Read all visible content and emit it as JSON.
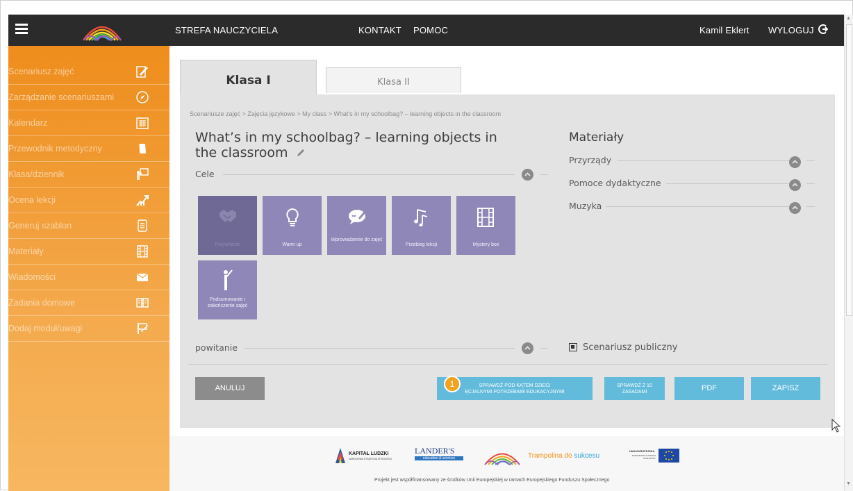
{
  "topbar": {
    "nav_strefa": "STREFA NAUCZYCIELA",
    "nav_kontakt": "KONTAKT",
    "nav_pomoc": "POMOC",
    "user_name": "Kamil Eklert",
    "logout": "WYLOGUJ"
  },
  "sidebar": {
    "items": [
      {
        "label": "Scenariusz zajęć",
        "icon": "edit-icon"
      },
      {
        "label": "Zarządzanie scenariuszami",
        "icon": "compass-icon"
      },
      {
        "label": "Kalendarz",
        "icon": "calendar-icon"
      },
      {
        "label": "Przewodnik metodyczny",
        "icon": "book-icon"
      },
      {
        "label": "Klasa/dziennik",
        "icon": "teacher-board-icon"
      },
      {
        "label": "Ocena lekcji",
        "icon": "chart-up-icon"
      },
      {
        "label": "Generuj szablon",
        "icon": "document-icon"
      },
      {
        "label": "Materiały",
        "icon": "film-icon"
      },
      {
        "label": "Wiadomości",
        "icon": "envelope-icon"
      },
      {
        "label": "Zadania domowe",
        "icon": "open-book-icon"
      },
      {
        "label": "Dodaj moduł/uwagi",
        "icon": "add-note-icon"
      }
    ]
  },
  "tabs": [
    {
      "label": "Klasa I",
      "active": true
    },
    {
      "label": "Klasa II",
      "active": false
    }
  ],
  "breadcrumb": "Scenariusze zajęć  >  Zajęcia językowe  >  My class  >  What's in my schoolbag? – learning objects in the classroom",
  "lesson": {
    "title": "What’s in my schoolbag? – learning objects in the classroom",
    "cele_label": "Cele",
    "powitanie_label": "powitanie"
  },
  "tiles": [
    {
      "label": "Przywitanie",
      "icon": "handshake-icon",
      "active": true
    },
    {
      "label": "Warm up",
      "icon": "lightbulb-icon",
      "active": false
    },
    {
      "label": "Wprowadzenie do zajęć",
      "icon": "speech-pen-icon",
      "active": false
    },
    {
      "label": "Przebieg lekcji",
      "icon": "music-note-icon",
      "active": false
    },
    {
      "label": "Mystery box",
      "icon": "film-icon",
      "active": false
    },
    {
      "label": "Podsumowanie i zakończenie zajęć",
      "icon": "presenter-icon",
      "active": false
    }
  ],
  "materials": {
    "title": "Materiały",
    "sections": [
      "Przyrządy",
      "Pomoce dydaktyczne",
      "Muzyka"
    ],
    "public_label": "Scenariusz publiczny"
  },
  "buttons": {
    "cancel": "ANULUJ",
    "check_special": "SPRAWDŹ POD KĄTEM DZIECI SPECJALNYMI POTRZEBAMI EDUKACYJNYMI",
    "check_special_visible": "SPRAWDŹ POD KĄTEM DZIECI\nĘCJALNYMI POTRZEBAMI EDUKACYJNYMI",
    "check_10": "SPRAWDŹ Z 10\nZASADAMI",
    "pdf": "PDF",
    "save": "ZAPISZ",
    "step_badge": "1"
  },
  "footer": {
    "kapital": "KAPITAŁ LUDZKI",
    "kapital_sub": "NARODOWA STRATEGIA SPÓJNOŚCI",
    "landers": "LANDER'S",
    "landers_sub": "education & services",
    "trampolina_a": "Trampolina do",
    "trampolina_b": " sukcesu",
    "ue_label": "UNIA EUROPEJSKA",
    "ue_sub": "EUROPEJSKI FUNDUSZ SPOŁECZNY",
    "note": "Projekt jest współfinansowany ze środków Unii Europejskiej w ramach Europejskiego Funduszu Społecznego"
  },
  "colors": {
    "topbar": "#2b2b2b",
    "sidebar": "#ee8d1c",
    "tile": "#8e87b8",
    "tile_active": "#6f6a95",
    "btn_blue": "#63bbdc",
    "btn_gray": "#8c8c8c",
    "badge": "#f2a21c"
  }
}
